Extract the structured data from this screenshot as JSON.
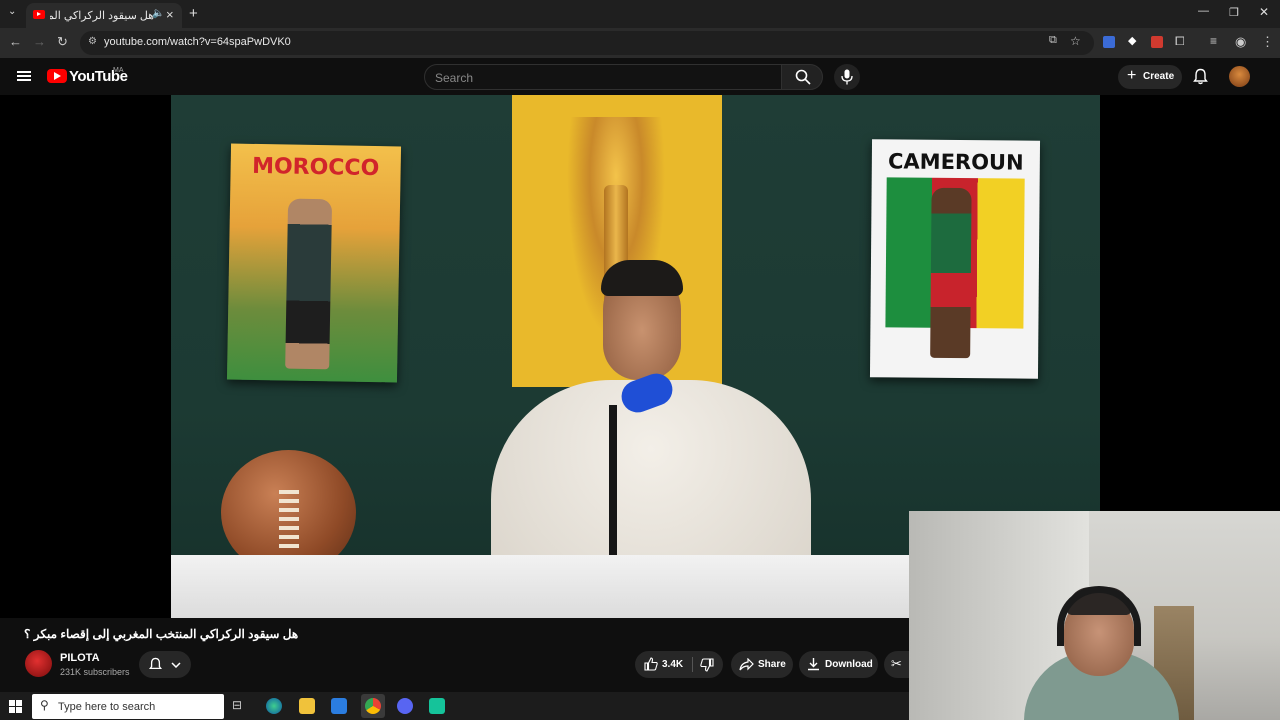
{
  "browser": {
    "tab_title": "هل سيقود الركراكي المنتخب",
    "new_tab": "+",
    "url": "youtube.com/watch?v=64spaPwDVK0",
    "window_controls": [
      "—",
      "❐",
      "✕"
    ]
  },
  "youtube": {
    "logo_text": "YouTube",
    "country_code": "MA",
    "search_placeholder": "Search",
    "create_label": "Create"
  },
  "video": {
    "poster_left_title": "MOROCCO",
    "poster_right_title": "CAMEROUN",
    "title": "هل سيقود الركراكي المنتخب المغربي إلى إقصاء مبكر ؟",
    "channel_name": "PILOTA",
    "subscribers": "231K subscribers",
    "likes": "3.4K",
    "share_label": "Share",
    "download_label": "Download"
  },
  "taskbar": {
    "search_placeholder": "Type here to search"
  },
  "icons": [
    "hamburger-icon",
    "search-icon",
    "mic-icon",
    "bell-icon",
    "like-icon",
    "dislike-icon",
    "share-icon",
    "download-icon",
    "clip-icon",
    "windows-start-icon"
  ]
}
